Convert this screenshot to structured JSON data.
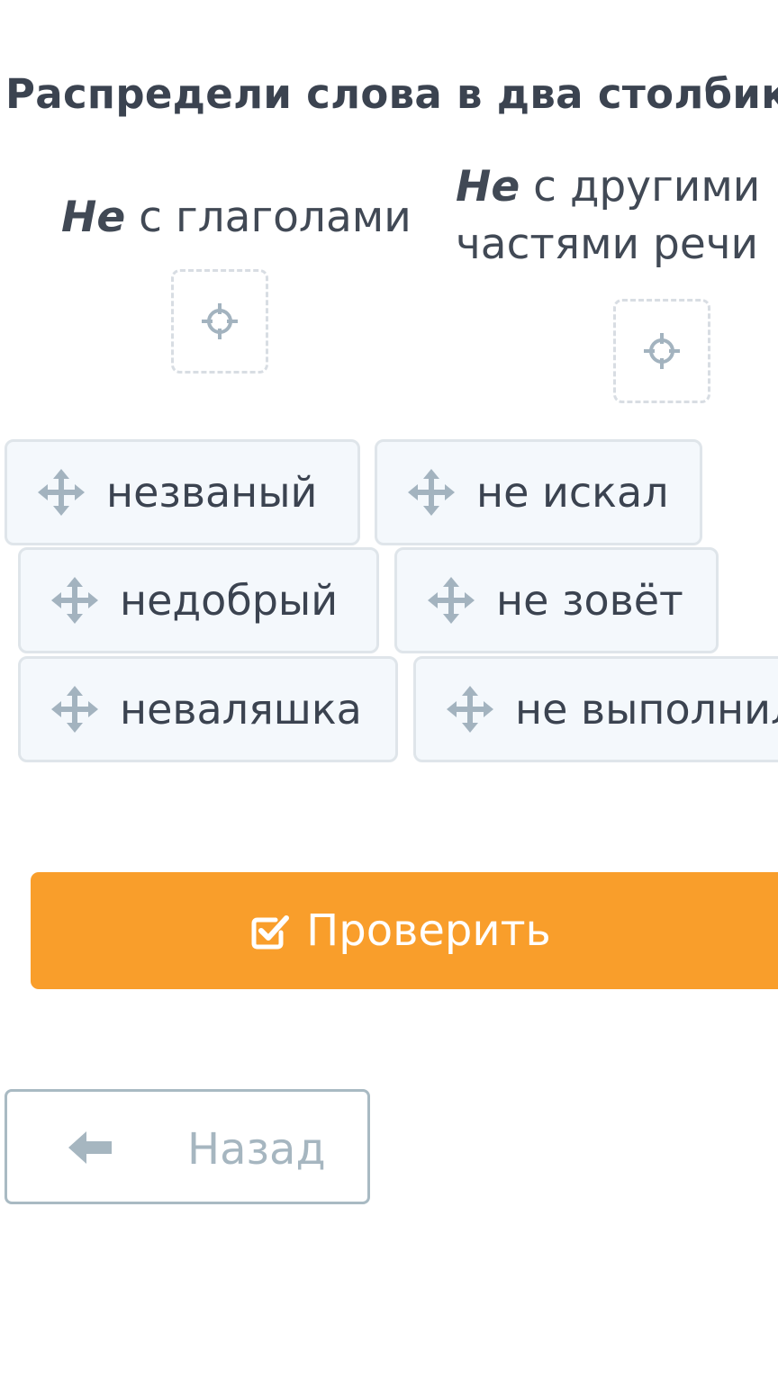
{
  "task": {
    "title": "Распредели слова в два столбика"
  },
  "columns": [
    {
      "emphasis": "Не",
      "rest": " с глаголами"
    },
    {
      "emphasis": "Не",
      "rest": " с другими частями речи"
    }
  ],
  "drop_zones": [
    {
      "icon": "target-icon"
    },
    {
      "icon": "target-icon"
    }
  ],
  "word_chips": [
    {
      "label": "незваный",
      "icon": "move-icon"
    },
    {
      "label": "не искал",
      "icon": "move-icon"
    },
    {
      "label": "недобрый",
      "icon": "move-icon"
    },
    {
      "label": "не зовёт",
      "icon": "move-icon"
    },
    {
      "label": "неваляшка",
      "icon": "move-icon"
    },
    {
      "label": "не выполнил",
      "icon": "move-icon"
    }
  ],
  "actions": {
    "check_label": "Проверить",
    "check_icon": "checkbox-checked-icon",
    "back_label": "Назад",
    "back_icon": "arrow-left-icon"
  },
  "colors": {
    "accent": "#f99e2b",
    "chip_background": "#f4f8fc",
    "chip_border": "#dfe5ea",
    "icon_gray": "#a3b3bf",
    "text": "#3b4350"
  }
}
